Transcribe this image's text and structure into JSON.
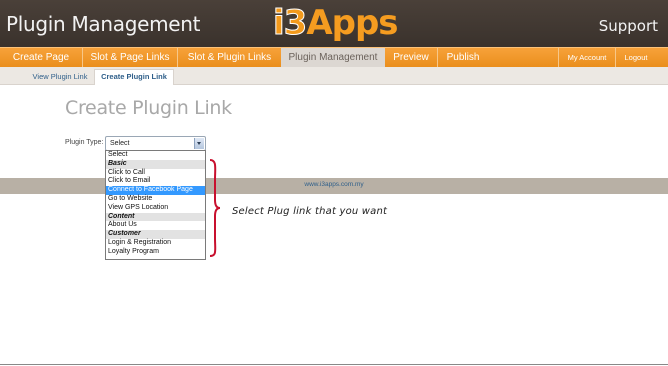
{
  "header": {
    "app_title": "Plugin Management",
    "logo_num": "i3",
    "logo_text": "Apps",
    "support": "Support"
  },
  "nav": {
    "items": [
      "Create Page",
      "Slot & Page Links",
      "Slot & Plugin Links",
      "Plugin Management",
      "Preview",
      "Publish"
    ],
    "active": "Plugin Management",
    "account": "My Account",
    "logout": "Logout"
  },
  "subnav": {
    "tabs": [
      "View Plugin Link",
      "Create Plugin Link"
    ],
    "active": "Create Plugin Link"
  },
  "main": {
    "heading": "Create Plugin Link",
    "plugin_type_label": "Plugin Type:",
    "plugin_type_value": "Select"
  },
  "dropdown": {
    "options": [
      {
        "label": "Select",
        "kind": "option"
      },
      {
        "label": "Basic",
        "kind": "group"
      },
      {
        "label": "Click to Call",
        "kind": "option"
      },
      {
        "label": "Click to Email",
        "kind": "option"
      },
      {
        "label": "Connect to Facebook Page",
        "kind": "option",
        "highlighted": true
      },
      {
        "label": "Go to Website",
        "kind": "option"
      },
      {
        "label": "View GPS Location",
        "kind": "option"
      },
      {
        "label": "Content",
        "kind": "group"
      },
      {
        "label": "About Us",
        "kind": "option"
      },
      {
        "label": "Customer",
        "kind": "group"
      },
      {
        "label": "Login & Registration",
        "kind": "option"
      },
      {
        "label": "Loyalty Program",
        "kind": "option"
      }
    ]
  },
  "footer": {
    "url": "www.i3apps.com.my"
  },
  "annotation": {
    "text": "Select Plug link that you want",
    "color": "#c8102e"
  },
  "colors": {
    "header_bg": "#3f3630",
    "nav_orange": "#f39a1c",
    "highlight": "#3399ff"
  }
}
